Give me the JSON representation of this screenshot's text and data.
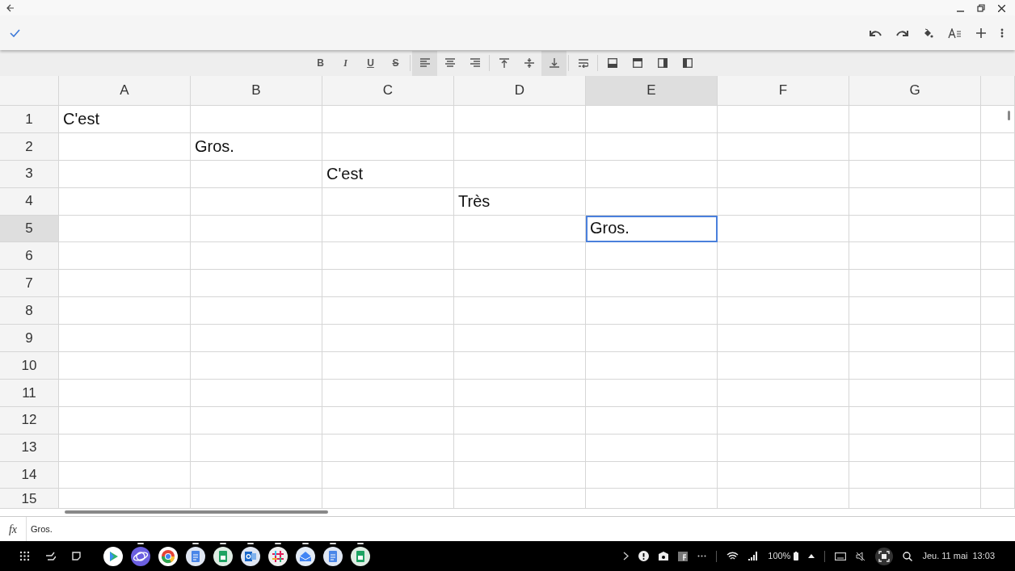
{
  "toolbar": {
    "buttons": [
      {
        "kind": "bold",
        "label": "B",
        "selected": false
      },
      {
        "kind": "italic",
        "label": "I",
        "selected": false
      },
      {
        "kind": "underline",
        "label": "U",
        "selected": false
      },
      {
        "kind": "strike",
        "label": "S",
        "selected": false
      },
      {
        "kind": "sep"
      },
      {
        "kind": "align-left",
        "selected": true
      },
      {
        "kind": "align-center",
        "selected": false
      },
      {
        "kind": "align-right",
        "selected": false
      },
      {
        "kind": "sep"
      },
      {
        "kind": "valign-top",
        "selected": false
      },
      {
        "kind": "valign-middle",
        "selected": false
      },
      {
        "kind": "valign-bottom",
        "selected": true
      },
      {
        "kind": "sep"
      },
      {
        "kind": "wrap",
        "selected": false
      },
      {
        "kind": "sep"
      },
      {
        "kind": "border-bottom",
        "selected": false
      },
      {
        "kind": "border-top",
        "selected": false
      },
      {
        "kind": "border-right",
        "selected": false
      },
      {
        "kind": "border-left",
        "selected": false
      }
    ]
  },
  "columns": [
    {
      "label": "A",
      "selected": false
    },
    {
      "label": "B",
      "selected": false
    },
    {
      "label": "C",
      "selected": false
    },
    {
      "label": "D",
      "selected": false
    },
    {
      "label": "E",
      "selected": true
    },
    {
      "label": "F",
      "selected": false
    },
    {
      "label": "G",
      "selected": false
    }
  ],
  "rows": [
    {
      "label": "1",
      "selected": false,
      "cells": [
        {
          "text": "C'est",
          "selected": false
        },
        {
          "selected": false
        },
        {
          "selected": false
        },
        {
          "selected": false
        },
        {
          "selected": false
        },
        {
          "selected": false
        },
        {
          "selected": false
        }
      ]
    },
    {
      "label": "2",
      "selected": false,
      "cells": [
        {
          "selected": false
        },
        {
          "text": "Gros.",
          "selected": false
        },
        {
          "selected": false
        },
        {
          "selected": false
        },
        {
          "selected": false
        },
        {
          "selected": false
        },
        {
          "selected": false
        }
      ]
    },
    {
      "label": "3",
      "selected": false,
      "cells": [
        {
          "selected": false
        },
        {
          "selected": false
        },
        {
          "text": "C'est",
          "selected": false
        },
        {
          "selected": false
        },
        {
          "selected": false
        },
        {
          "selected": false
        },
        {
          "selected": false
        }
      ]
    },
    {
      "label": "4",
      "selected": false,
      "cells": [
        {
          "selected": false
        },
        {
          "selected": false
        },
        {
          "selected": false
        },
        {
          "text": "Très",
          "selected": false
        },
        {
          "selected": false
        },
        {
          "selected": false
        },
        {
          "selected": false
        }
      ]
    },
    {
      "label": "5",
      "selected": true,
      "cells": [
        {
          "selected": false
        },
        {
          "selected": false
        },
        {
          "selected": false
        },
        {
          "selected": false
        },
        {
          "text": "Gros.",
          "selected": true
        },
        {
          "selected": false
        },
        {
          "selected": false
        }
      ]
    },
    {
      "label": "6",
      "selected": false,
      "cells": [
        {
          "selected": false
        },
        {
          "selected": false
        },
        {
          "selected": false
        },
        {
          "selected": false
        },
        {
          "selected": false
        },
        {
          "selected": false
        },
        {
          "selected": false
        }
      ]
    },
    {
      "label": "7",
      "selected": false,
      "cells": [
        {
          "selected": false
        },
        {
          "selected": false
        },
        {
          "selected": false
        },
        {
          "selected": false
        },
        {
          "selected": false
        },
        {
          "selected": false
        },
        {
          "selected": false
        }
      ]
    },
    {
      "label": "8",
      "selected": false,
      "cells": [
        {
          "selected": false
        },
        {
          "selected": false
        },
        {
          "selected": false
        },
        {
          "selected": false
        },
        {
          "selected": false
        },
        {
          "selected": false
        },
        {
          "selected": false
        }
      ]
    },
    {
      "label": "9",
      "selected": false,
      "cells": [
        {
          "selected": false
        },
        {
          "selected": false
        },
        {
          "selected": false
        },
        {
          "selected": false
        },
        {
          "selected": false
        },
        {
          "selected": false
        },
        {
          "selected": false
        }
      ]
    },
    {
      "label": "10",
      "selected": false,
      "cells": [
        {
          "selected": false
        },
        {
          "selected": false
        },
        {
          "selected": false
        },
        {
          "selected": false
        },
        {
          "selected": false
        },
        {
          "selected": false
        },
        {
          "selected": false
        }
      ]
    },
    {
      "label": "11",
      "selected": false,
      "cells": [
        {
          "selected": false
        },
        {
          "selected": false
        },
        {
          "selected": false
        },
        {
          "selected": false
        },
        {
          "selected": false
        },
        {
          "selected": false
        },
        {
          "selected": false
        }
      ]
    },
    {
      "label": "12",
      "selected": false,
      "cells": [
        {
          "selected": false
        },
        {
          "selected": false
        },
        {
          "selected": false
        },
        {
          "selected": false
        },
        {
          "selected": false
        },
        {
          "selected": false
        },
        {
          "selected": false
        }
      ]
    },
    {
      "label": "13",
      "selected": false,
      "cells": [
        {
          "selected": false
        },
        {
          "selected": false
        },
        {
          "selected": false
        },
        {
          "selected": false
        },
        {
          "selected": false
        },
        {
          "selected": false
        },
        {
          "selected": false
        }
      ]
    },
    {
      "label": "14",
      "selected": false,
      "cells": [
        {
          "selected": false
        },
        {
          "selected": false
        },
        {
          "selected": false
        },
        {
          "selected": false
        },
        {
          "selected": false
        },
        {
          "selected": false
        },
        {
          "selected": false
        }
      ]
    },
    {
      "label": "15",
      "selected": false,
      "cells": [
        {
          "selected": false
        },
        {
          "selected": false
        },
        {
          "selected": false
        },
        {
          "selected": false
        },
        {
          "selected": false
        },
        {
          "selected": false
        },
        {
          "selected": false
        }
      ]
    }
  ],
  "formula_bar": {
    "label": "fx",
    "value": "Gros."
  },
  "taskbar": {
    "apps": [
      {
        "kind": "triangle",
        "running": false
      },
      {
        "kind": "planet",
        "running": true
      },
      {
        "kind": "ring",
        "running": false
      },
      {
        "kind": "doc",
        "running": true
      },
      {
        "kind": "sheet",
        "running": true
      },
      {
        "kind": "mail",
        "running": true
      },
      {
        "kind": "hash",
        "running": true
      },
      {
        "kind": "inbox",
        "running": true
      },
      {
        "kind": "doc",
        "running": true
      },
      {
        "kind": "sheet",
        "running": true
      }
    ],
    "battery": "100%",
    "date": "Jeu. 11 mai",
    "time": "13:03"
  }
}
